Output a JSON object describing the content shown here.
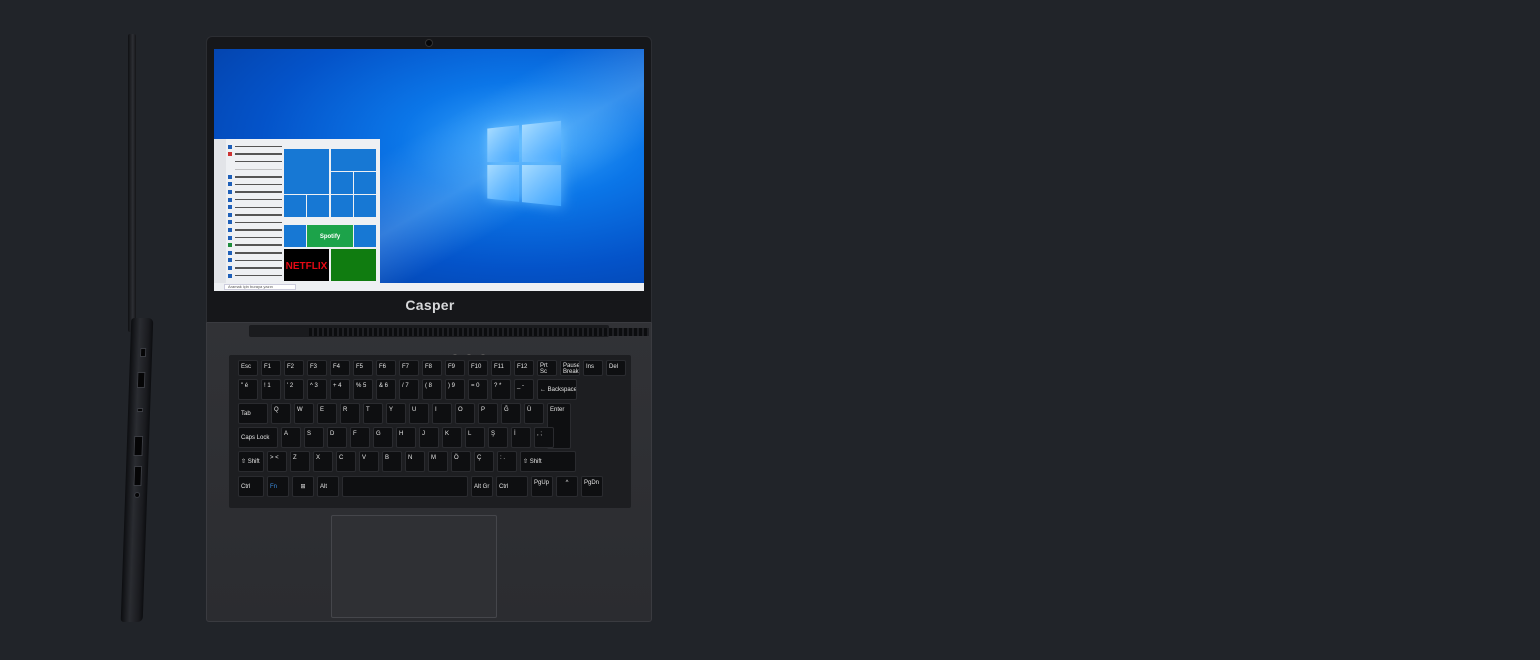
{
  "brand": "Casper",
  "screen": {
    "search_placeholder": "Aramak için buraya yazın",
    "tiles": {
      "spotify": "Spotify",
      "netflix": "NETFLIX"
    }
  },
  "keyboard": {
    "rows": [
      [
        "Esc",
        "F1",
        "F2",
        "F3",
        "F4",
        "F5",
        "F6",
        "F7",
        "F8",
        "F9",
        "F10",
        "F11",
        "F12",
        "Prt Sc SysRq",
        "Pause Break",
        "Ins",
        "Del"
      ],
      [
        "\" é",
        "! 1",
        "' 2",
        "^ 3",
        "+ 4",
        "% 5",
        "& 6",
        "/ 7",
        "( 8",
        ") 9",
        "= 0",
        "? *",
        "_ -",
        "← Backspace"
      ],
      [
        "Tab",
        "Q",
        "W",
        "E",
        "R",
        "T",
        "Y",
        "U",
        "I",
        "O",
        "P",
        "Ğ",
        "Ü",
        "Enter"
      ],
      [
        "Caps Lock",
        "A",
        "S",
        "D",
        "F",
        "G",
        "H",
        "J",
        "K",
        "L",
        "Ş",
        "İ",
        ", ;"
      ],
      [
        "⇧ Shift",
        "> <",
        "Z",
        "X",
        "C",
        "V",
        "B",
        "N",
        "M",
        "Ö",
        "Ç",
        ": .",
        "⇧ Shift"
      ],
      [
        "Ctrl",
        "Fn",
        "⊞",
        "Alt",
        "",
        "Alt Gr",
        "Ctrl",
        "PgUp",
        "^",
        "PgDn"
      ]
    ]
  },
  "colors": {
    "background": "#212429",
    "fn_legend": "#3d8ee0"
  }
}
